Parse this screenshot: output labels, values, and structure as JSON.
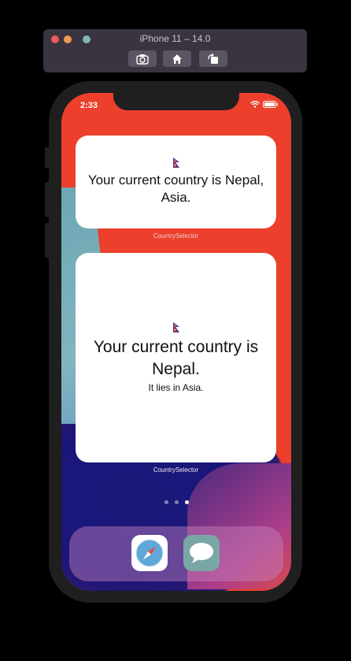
{
  "simulator": {
    "title": "iPhone 11 – 14.0",
    "toolbar": [
      "screenshot-icon",
      "home-icon",
      "rotate-icon"
    ]
  },
  "status_bar": {
    "time": "2:33"
  },
  "widgets": {
    "small": {
      "flag": "nepal-flag-icon",
      "text": "Your current country is Nepal, Asia.",
      "label": "CountrySelector"
    },
    "large": {
      "flag": "nepal-flag-icon",
      "text": "Your current country is Nepal.",
      "subtext": "It lies in Asia.",
      "label": "CountrySelector"
    }
  },
  "home": {
    "page_count": 3,
    "active_page": 3
  },
  "dock": {
    "apps": [
      "safari-icon",
      "messages-icon"
    ]
  },
  "colors": {
    "wallpaper_accent": "#ec3f2c",
    "widget_background": "#ffffff"
  }
}
